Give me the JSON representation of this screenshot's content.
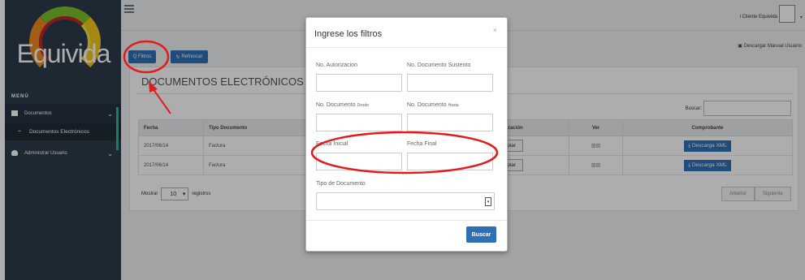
{
  "sidebar": {
    "logo_text": "Equivida",
    "menu_title": "MENÚ",
    "items": [
      {
        "label": "Documentos",
        "icon": "document-icon"
      },
      {
        "label": "Documentos Electrónicos"
      },
      {
        "label": "Administrar Usuario",
        "icon": "user-icon"
      }
    ]
  },
  "header": {
    "user_name": "i Cliente Equivida",
    "manual_link": "Descargar Manual Usuario"
  },
  "toolbar": {
    "filtros_label": "Q Filtros",
    "refrescar_label": "Refrescar"
  },
  "panel": {
    "title": "DOCUMENTOS ELECTRÓNICOS",
    "buscar_label": "Buscar:",
    "columns": [
      "Fecha",
      "Tipo Documento",
      "Autorización",
      "Ver",
      "Comprobante"
    ],
    "rows": [
      {
        "fecha": "2017/06/14",
        "tipo": "Factura",
        "autorizacion": "Copiar",
        "ver": "▧▧",
        "comprobante": "Descarga XML"
      },
      {
        "fecha": "2017/06/14",
        "tipo": "Factura",
        "autorizacion": "Copiar",
        "ver": "▧▧",
        "comprobante": "Descarga XML"
      }
    ],
    "mostrar_label": "Mostrar",
    "mostrar_value": "10",
    "registros_label": "registros",
    "pager_prev": "Anterior",
    "pager_next": "Siguiente"
  },
  "modal": {
    "title": "Ingrese los filtros",
    "close": "×",
    "labels": {
      "no_autorizacion": "No. Autorizacion",
      "no_documento_sustento": "No. Documento Sustento",
      "no_documento_desde": "No. Documento",
      "desde": "Desde",
      "no_documento_hasta": "No. Documento",
      "hasta": "Hasta",
      "fecha_inicial": "Fecha Inicial",
      "fecha_final": "Fecha Final",
      "tipo_documento": "Tipo de Documento"
    },
    "buscar_button": "Buscar"
  },
  "colors": {
    "sidebar": "#2c3b4a",
    "accent": "#2f70b5",
    "teal": "#1abc9c",
    "annotation": "#e31b1b"
  }
}
